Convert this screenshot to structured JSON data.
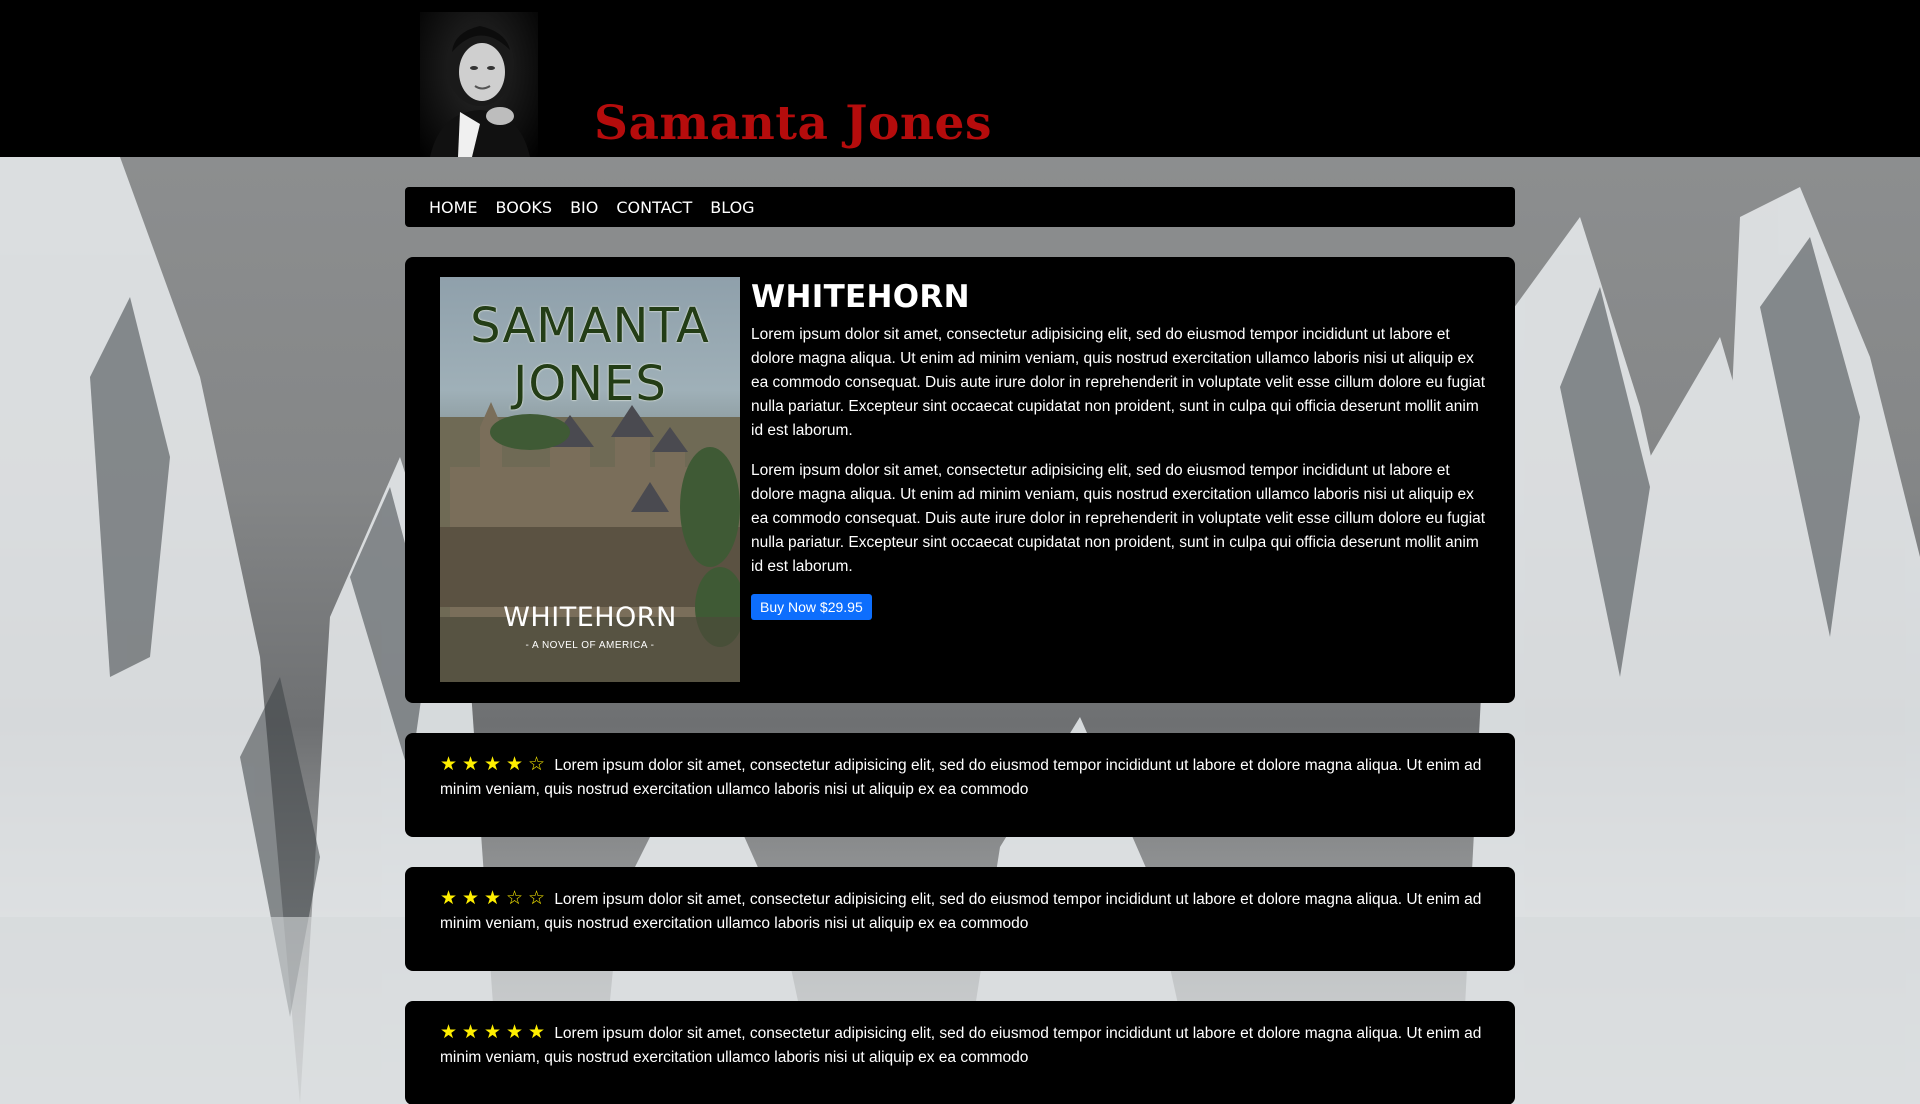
{
  "site": {
    "author_name": "Samanta Jones"
  },
  "nav": {
    "items": [
      {
        "label": "HOME"
      },
      {
        "label": "BOOKS"
      },
      {
        "label": "BIO"
      },
      {
        "label": "CONTACT"
      },
      {
        "label": "BLOG"
      }
    ]
  },
  "book": {
    "title": "WHITEHORN",
    "cover": {
      "author_line1": "SAMANTA",
      "author_line2": "JONES",
      "title": "WHITEHORN",
      "subtitle": "- A NOVEL OF AMERICA -"
    },
    "paragraphs": [
      "Lorem ipsum dolor sit amet, consectetur adipisicing elit, sed do eiusmod tempor incididunt ut labore et dolore magna aliqua. Ut enim ad minim veniam, quis nostrud exercitation ullamco laboris nisi ut aliquip ex ea commodo consequat. Duis aute irure dolor in reprehenderit in voluptate velit esse cillum dolore eu fugiat nulla pariatur. Excepteur sint occaecat cupidatat non proident, sunt in culpa qui officia deserunt mollit anim id est laborum.",
      "Lorem ipsum dolor sit amet, consectetur adipisicing elit, sed do eiusmod tempor incididunt ut labore et dolore magna aliqua. Ut enim ad minim veniam, quis nostrud exercitation ullamco laboris nisi ut aliquip ex ea commodo consequat. Duis aute irure dolor in reprehenderit in voluptate velit esse cillum dolore eu fugiat nulla pariatur. Excepteur sint occaecat cupidatat non proident, sunt in culpa qui officia deserunt mollit anim id est laborum."
    ],
    "buy_label": "Buy Now $29.95"
  },
  "reviews": [
    {
      "rating": 4,
      "max": 5,
      "text": "Lorem ipsum dolor sit amet, consectetur adipisicing elit, sed do eiusmod tempor incididunt ut labore et dolore magna aliqua. Ut enim ad minim veniam, quis nostrud exercitation ullamco laboris nisi ut aliquip ex ea commodo"
    },
    {
      "rating": 3,
      "max": 5,
      "text": "Lorem ipsum dolor sit amet, consectetur adipisicing elit, sed do eiusmod tempor incididunt ut labore et dolore magna aliqua. Ut enim ad minim veniam, quis nostrud exercitation ullamco laboris nisi ut aliquip ex ea commodo"
    },
    {
      "rating": 5,
      "max": 5,
      "text": "Lorem ipsum dolor sit amet, consectetur adipisicing elit, sed do eiusmod tempor incididunt ut labore et dolore magna aliqua. Ut enim ad minim veniam, quis nostrud exercitation ullamco laboris nisi ut aliquip ex ea commodo"
    }
  ],
  "colors": {
    "title_red": "#b50c0c",
    "panel_bg": "#000000",
    "button_blue": "#0d6efd",
    "star_yellow": "#ffef00"
  }
}
